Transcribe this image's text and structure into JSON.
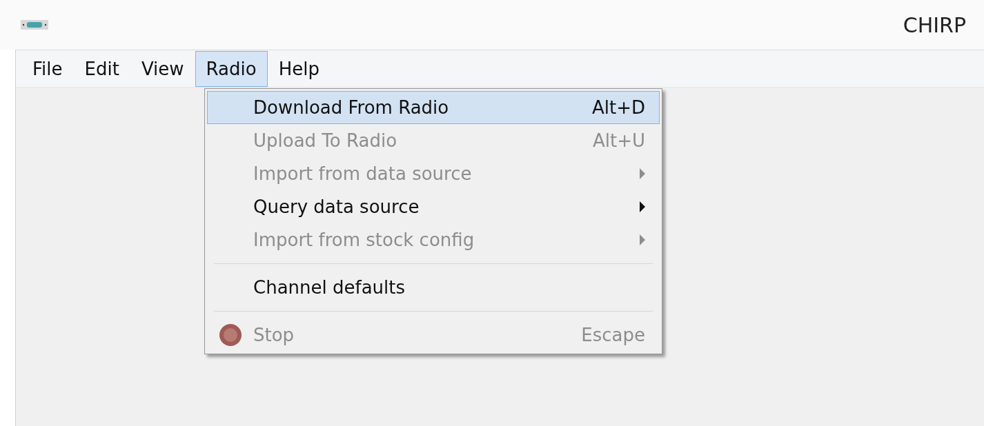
{
  "window": {
    "title": "CHIRP"
  },
  "menu_bar": [
    {
      "label": "File",
      "selected": false
    },
    {
      "label": "Edit",
      "selected": false
    },
    {
      "label": "View",
      "selected": false
    },
    {
      "label": "Radio",
      "selected": true
    },
    {
      "label": "Help",
      "selected": false
    }
  ],
  "menu": [
    {
      "kind": "item",
      "label": "Download From Radio",
      "shortcut": "Alt+D",
      "disabled": false,
      "selected": true,
      "submenu": false
    },
    {
      "kind": "item",
      "label": "Upload To Radio",
      "shortcut": "Alt+U",
      "disabled": true,
      "selected": false,
      "submenu": false
    },
    {
      "kind": "item",
      "label": "Import from data source",
      "disabled": true,
      "selected": false,
      "submenu": true
    },
    {
      "kind": "item",
      "label": "Query data source",
      "disabled": false,
      "selected": false,
      "submenu": true
    },
    {
      "kind": "item",
      "label": "Import from stock config",
      "disabled": true,
      "selected": false,
      "submenu": true
    },
    {
      "kind": "separator"
    },
    {
      "kind": "item",
      "label": "Channel defaults",
      "disabled": false,
      "selected": false,
      "submenu": false
    },
    {
      "kind": "separator"
    },
    {
      "kind": "stop_item",
      "label": "Stop",
      "shortcut": "Escape",
      "disabled": true,
      "selected": false,
      "submenu": false
    }
  ]
}
